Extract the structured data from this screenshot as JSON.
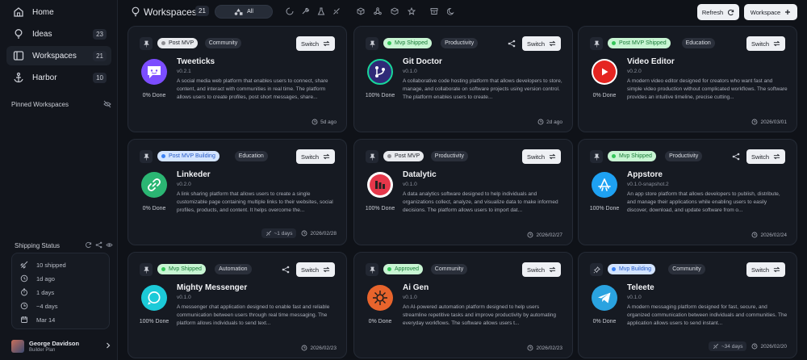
{
  "sidebar": {
    "items": [
      {
        "label": "Home",
        "badge": "",
        "icon": "home-icon"
      },
      {
        "label": "Ideas",
        "badge": "23",
        "icon": "lightbulb-icon"
      },
      {
        "label": "Workspaces",
        "badge": "21",
        "icon": "workspace-icon"
      },
      {
        "label": "Harbor",
        "badge": "10",
        "icon": "anchor-icon"
      }
    ],
    "pinned_title": "Pinned Workspaces",
    "shipping_title": "Shipping Status",
    "shipping": [
      {
        "label": "10 shipped",
        "icon": "rocket-icon"
      },
      {
        "label": "1d ago",
        "icon": "history-icon"
      },
      {
        "label": "1 days",
        "icon": "timer-icon"
      },
      {
        "label": "~4 days",
        "icon": "clock-icon"
      },
      {
        "label": "Mar 14",
        "icon": "calendar-icon"
      }
    ],
    "user": {
      "name": "George Davidson",
      "plan": "Builder Plan"
    }
  },
  "topbar": {
    "title": "Workspaces",
    "count": "21",
    "filter_all": "All",
    "refresh_label": "Refresh",
    "workspace_label": "Workspace"
  },
  "colors": {
    "green": "#34c759",
    "blue": "#3b82f6",
    "gray": "#8e8e93"
  },
  "cards": [
    {
      "status": "Post MVP",
      "category": "Community",
      "switch": "Switch",
      "name": "Tweeticks",
      "version": "v0.2.1",
      "description": "A social media web platform that enables users to connect, share content, and interact with communities in real time. The platform allows users to create profiles, post short messages, share...",
      "done": "0% Done",
      "meta1": "",
      "meta2": "5d ago"
    },
    {
      "status": "Mvp Shipped",
      "category": "Productivity",
      "switch": "Switch",
      "name": "Git Doctor",
      "version": "v0.1.0",
      "description": "A collaborative code hosting platform that allows developers to store, manage, and collaborate on software projects using version control. The platform enables users to create...",
      "done": "100% Done",
      "meta1": "",
      "meta2": "2d ago"
    },
    {
      "status": "Post MVP Shipped",
      "category": "Education",
      "switch": "Switch",
      "name": "Video Editor",
      "version": "v0.2.0",
      "description": "A modern video editor designed for creators who want fast and simple video production without complicated workflows. The software provides an intuitive timeline, precise cutting...",
      "done": "0% Done",
      "meta1": "",
      "meta2": "2026/03/01"
    },
    {
      "status": "Post MVP Building",
      "category": "Education",
      "switch": "Switch",
      "name": "Linkeder",
      "version": "v0.2.0",
      "description": "A link sharing platform that allows users to create a single customizable page containing multiple links to their websites, social profiles, products, and content. It helps overcome the...",
      "done": "0% Done",
      "meta1": "~1 days",
      "meta2": "2026/02/28"
    },
    {
      "status": "Post MVP",
      "category": "Productivity",
      "switch": "Switch",
      "name": "Datalytic",
      "version": "v0.1.0",
      "description": "A data analytics software designed to help individuals and organizations collect, analyze, and visualize data to make informed decisions. The platform allows users to import dat...",
      "done": "100% Done",
      "meta1": "",
      "meta2": "2026/02/27"
    },
    {
      "status": "Mvp Shipped",
      "category": "Productivity",
      "switch": "Switch",
      "name": "Appstore",
      "version": "v0.1.0-snapshot.2",
      "description": "An app store platform that allows developers to publish, distribute, and manage their applications while enabling users to easily discover, download, and update software from o...",
      "done": "100% Done",
      "meta1": "",
      "meta2": "2026/02/24"
    },
    {
      "status": "Mvp Shipped",
      "category": "Automation",
      "switch": "Switch",
      "name": "Mighty Messenger",
      "version": "v0.1.0",
      "description": "A messenger chat application designed to enable fast and reliable communication between users through real time messaging. The platform allows individuals to send text...",
      "done": "100% Done",
      "meta1": "",
      "meta2": "2026/02/23"
    },
    {
      "status": "Approved",
      "category": "Community",
      "switch": "Switch",
      "name": "Ai Gen",
      "version": "v0.1.0",
      "description": "An AI-powered automation platform designed to help users streamline repetitive tasks and improve productivity by automating everyday workflows. The software allows users t...",
      "done": "0% Done",
      "meta1": "",
      "meta2": "2026/02/23"
    },
    {
      "status": "Mvp Building",
      "category": "Community",
      "switch": "Switch",
      "name": "Teleete",
      "version": "v0.1.0",
      "description": "A modern messaging platform designed for fast, secure, and organized communication between individuals and communities. The application allows users to send instant...",
      "done": "0% Done",
      "meta1": "~34 days",
      "meta2": "2026/02/20"
    }
  ]
}
